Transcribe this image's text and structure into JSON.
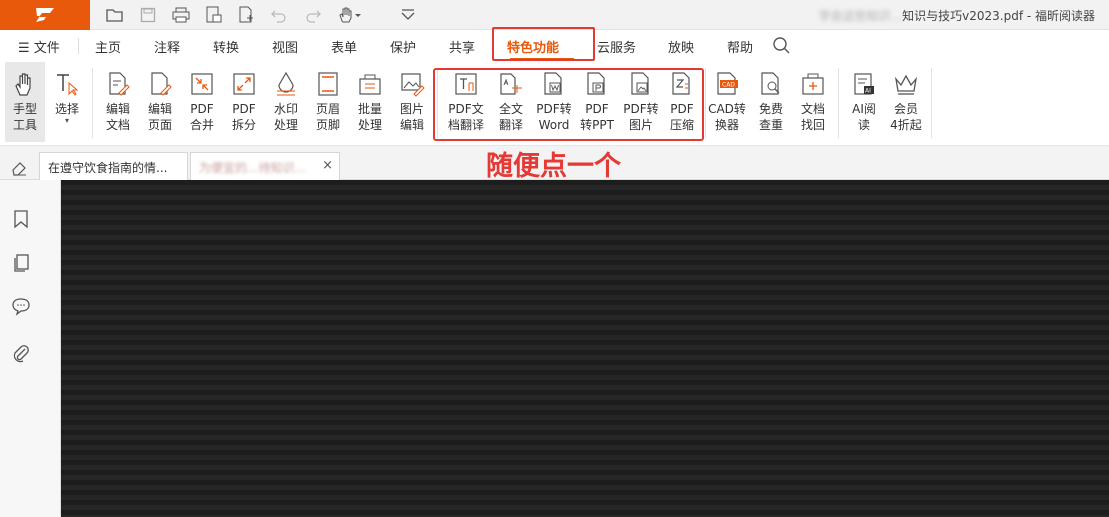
{
  "title_bar": {
    "document_title_blurred": "学会这些知识...",
    "document_title_visible": "知识与技巧v2023.pdf - 福昕阅读器",
    "quick_access": [
      "open-icon",
      "save-icon",
      "print-icon",
      "export-icon",
      "new-icon",
      "undo-icon",
      "redo-icon",
      "hand-dropdown-icon",
      "customize-icon"
    ]
  },
  "menu": {
    "file": "文件",
    "items": [
      "主页",
      "注释",
      "转换",
      "视图",
      "表单",
      "保护",
      "共享",
      "特色功能",
      "云服务",
      "放映",
      "帮助"
    ],
    "active": "特色功能"
  },
  "ribbon": {
    "tools": [
      {
        "label": "手型\n工具",
        "icon": "hand-icon"
      },
      {
        "label": "选择",
        "icon": "select-text-icon"
      },
      {
        "label": "编辑\n文档",
        "icon": "edit-doc-icon"
      },
      {
        "label": "编辑\n页面",
        "icon": "edit-page-icon"
      },
      {
        "label": "PDF\n合并",
        "icon": "merge-icon"
      },
      {
        "label": "PDF\n拆分",
        "icon": "split-icon"
      },
      {
        "label": "水印\n处理",
        "icon": "watermark-icon"
      },
      {
        "label": "页眉\n页脚",
        "icon": "header-footer-icon"
      },
      {
        "label": "批量\n处理",
        "icon": "batch-icon"
      },
      {
        "label": "图片\n编辑",
        "icon": "image-edit-icon"
      },
      {
        "label": "PDF文\n档翻译",
        "icon": "doc-translate-icon"
      },
      {
        "label": "全文\n翻译",
        "icon": "full-translate-icon"
      },
      {
        "label": "PDF转\nWord",
        "icon": "pdf-to-word-icon"
      },
      {
        "label": "PDF\n转PPT",
        "icon": "pdf-to-ppt-icon"
      },
      {
        "label": "PDF转\n图片",
        "icon": "pdf-to-image-icon"
      },
      {
        "label": "PDF\n压缩",
        "icon": "pdf-compress-icon"
      },
      {
        "label": "CAD转\n换器",
        "icon": "cad-icon"
      },
      {
        "label": "免费\n查重",
        "icon": "plagiarism-icon"
      },
      {
        "label": "文档\n找回",
        "icon": "recover-icon"
      },
      {
        "label": "AI阅\n读",
        "icon": "ai-read-icon"
      },
      {
        "label": "会员\n4折起",
        "icon": "crown-icon"
      }
    ]
  },
  "annotation": "随便点一个",
  "tabs": [
    {
      "label": "在遵守饮食指南的情..."
    },
    {
      "label": "为便宜的...待知识...",
      "close": "×"
    }
  ],
  "sidebar": [
    "bookmark-icon",
    "pages-icon",
    "comments-icon",
    "attachment-icon"
  ],
  "colors": {
    "brand": "#e8590c",
    "annotation": "#e53935",
    "viewer_bg": "#1d1d1d"
  }
}
